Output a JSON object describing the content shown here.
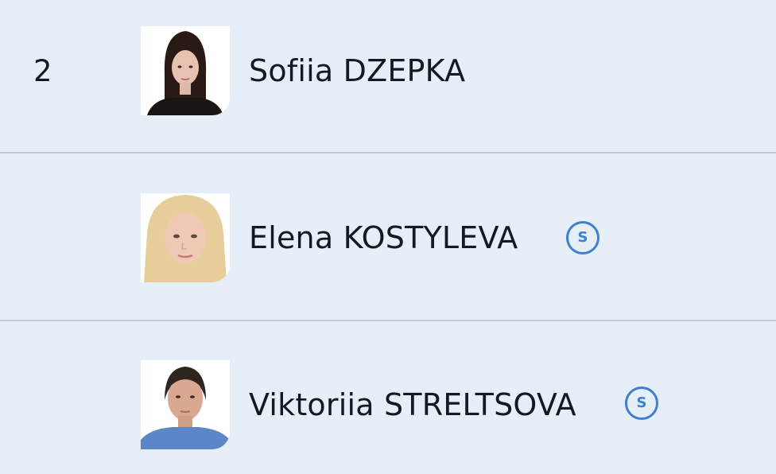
{
  "athletes": [
    {
      "rank": "2",
      "name": "Sofiia DZEPKA",
      "photo_icon": "athlete-photo-dark-hair",
      "badge": ""
    },
    {
      "rank": "",
      "name": "Elena KOSTYLEVA",
      "photo_icon": "athlete-photo-blonde-hair",
      "badge": "S"
    },
    {
      "rank": "",
      "name": "Viktoriia STRELTSOVA",
      "photo_icon": "athlete-photo-dark-hair-blue-top",
      "badge": "S"
    }
  ],
  "colors": {
    "background": "#e6eff8",
    "divider": "#c7ccd2",
    "text": "#141a22",
    "badge_accent": "#3f7fd3"
  }
}
